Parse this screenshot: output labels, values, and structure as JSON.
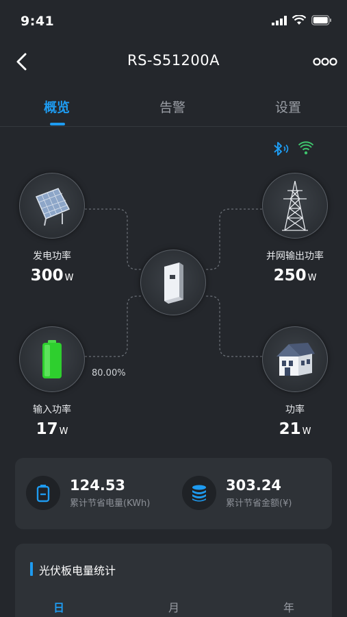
{
  "status_bar": {
    "time": "9:41"
  },
  "nav": {
    "title": "RS-S51200A"
  },
  "tabs": [
    {
      "label": "概览",
      "active": true
    },
    {
      "label": "告警",
      "active": false
    },
    {
      "label": "设置",
      "active": false
    }
  ],
  "connection": {
    "bluetooth_color": "#1e9bf0",
    "wifi_color": "#3ec46d"
  },
  "nodes": {
    "solar": {
      "label": "发电功率",
      "value": "300",
      "unit": "W"
    },
    "grid": {
      "label": "并网输出功率",
      "value": "250",
      "unit": "W"
    },
    "battery": {
      "label": "输入功率",
      "value": "17",
      "unit": "W",
      "percent": "80.00%"
    },
    "home": {
      "label": "功率",
      "value": "21",
      "unit": "W"
    }
  },
  "stats": {
    "energy": {
      "value": "124.53",
      "label": "累计节省电量(KWh)"
    },
    "money": {
      "value": "303.24",
      "label": "累计节省金额(¥)"
    }
  },
  "chart_section": {
    "title": "光伏板电量统计",
    "periods": [
      {
        "label": "日",
        "active": true
      },
      {
        "label": "月",
        "active": false
      },
      {
        "label": "年",
        "active": false
      }
    ]
  },
  "colors": {
    "accent": "#1e9bf0",
    "background": "#24272c",
    "card": "#2e3237"
  }
}
